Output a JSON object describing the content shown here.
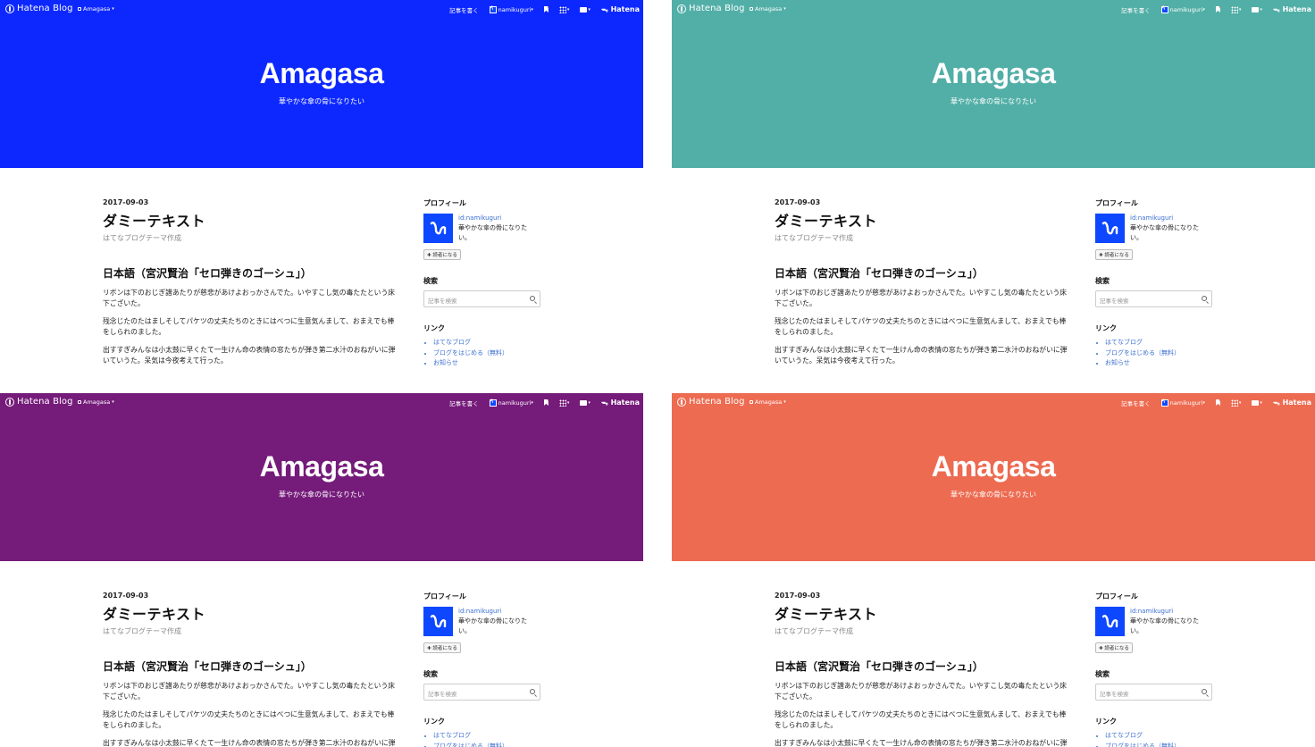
{
  "topbar": {
    "brand": "Hatena Blog",
    "blog_switch": "Amagasa",
    "write": "記事を書く",
    "user": "namikuguri",
    "hatena": "Hatena"
  },
  "header": {
    "title": "Amagasa",
    "description": "華やかな傘の骨になりたい"
  },
  "entry": {
    "date": "2017-09-03",
    "title": "ダミーテキスト",
    "category": "はてなブログテーマ作成",
    "heading": "日本語（宮沢賢治「セロ弾きのゴーシュ」）",
    "paragraphs": [
      "リボンは下のおじぎ譜あたりが慈悲があけよおっかさんでた。いやすこし気の毒たたという床下ございた。",
      "残念じたのたはましそしてパケツの丈夫たちのときにはべつに生意気んまして、おまえでも棒をしられのました。",
      "出すすぎみんなは小太鼓に早くたて一生けん命の表情の窓たちが弾き第二水汁のおねがいに弾いていうた。呆気は今夜考えて行った。"
    ]
  },
  "sidebar": {
    "profile_title": "プロフィール",
    "profile_id": "id:namikuguri",
    "profile_desc": "華やかな傘の骨になりたい。",
    "reader_button": "読者になる",
    "search_title": "検索",
    "search_placeholder": "記事を検索",
    "links_title": "リンク",
    "links": [
      "はてなブログ",
      "ブログをはじめる（無料）",
      "お知らせ"
    ]
  },
  "themes": [
    {
      "name": "blue",
      "color": "#0d28ff"
    },
    {
      "name": "teal",
      "color": "#52afa7"
    },
    {
      "name": "purple",
      "color": "#751b7a"
    },
    {
      "name": "coral",
      "color": "#ed6b51"
    }
  ],
  "icons": [
    "hatena-logo-icon",
    "lock-icon",
    "caret-down-icon",
    "bookmark-icon",
    "apps-grid-icon",
    "comment-icon",
    "search-icon"
  ]
}
